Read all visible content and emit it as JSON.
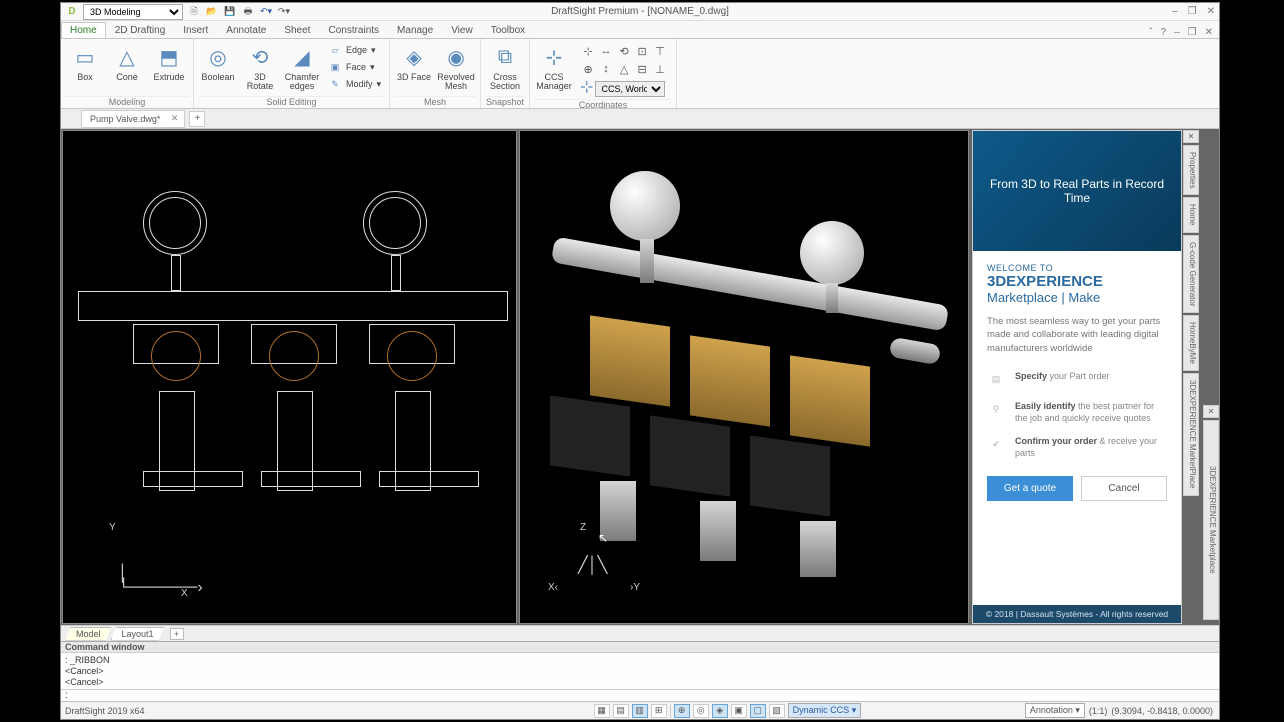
{
  "workspace": "3D Modeling",
  "app_title": "DraftSight Premium - [NONAME_0.dwg]",
  "window_controls": {
    "min": "–",
    "max": "❐",
    "close": "✕"
  },
  "menu_right": {
    "expand": "ˇ",
    "help": "?",
    "min": "–",
    "max": "❐",
    "close": "✕"
  },
  "tabs": {
    "items": [
      "Home",
      "2D Drafting",
      "Insert",
      "Annotate",
      "Sheet",
      "Constraints",
      "Manage",
      "View",
      "Toolbox"
    ],
    "active": "Home"
  },
  "ribbon": {
    "modeling": {
      "label": "Modeling",
      "box": "Box",
      "cone": "Cone",
      "extrude": "Extrude"
    },
    "solid_editing": {
      "label": "Solid Editing",
      "boolean": "Boolean",
      "rotate": "3D Rotate",
      "chamfer": "Chamfer edges",
      "edge": "Edge",
      "face": "Face",
      "modify": "Modify"
    },
    "mesh": {
      "label": "Mesh",
      "face3d": "3D Face",
      "revolved": "Revolved Mesh"
    },
    "snapshot": {
      "label": "Snapshot",
      "cross": "Cross Section"
    },
    "coords": {
      "label": "Coordinates",
      "ccs": "CCS Manager",
      "sys_label": "CCS, World"
    }
  },
  "file_tab": {
    "name": "Pump Valve.dwg*"
  },
  "viewport": {
    "left_axes": {
      "x": "X",
      "y": "Y"
    },
    "right_axes": {
      "x": "X",
      "y": "Y",
      "z": "Z"
    }
  },
  "panel": {
    "banner": "From 3D to Real Parts in Record Time",
    "welcome": "WELCOME TO",
    "title1": "3DEXPERIENCE",
    "title2": "Marketplace | Make",
    "desc": "The most seamless way to get your parts made and collaborate with leading digital manufacturers worldwide",
    "feat1_b": "Specify",
    "feat1_t": " your Part order",
    "feat2_b": "Easily identify",
    "feat2_t": " the best partner for the job and quickly receive quotes",
    "feat3_b": "Confirm your order",
    "feat3_t": " & receive your parts",
    "btn_primary": "Get a quote",
    "btn_cancel": "Cancel",
    "footer": "© 2018 | Dassault Systèmes - All rights reserved"
  },
  "vtabs": [
    "Properties",
    "Home",
    "G-code Generator",
    "HomeByMe",
    "3DEXPERIENCE MarketPlace"
  ],
  "vtab_secondary": "3DEXPERIENCE Marketplace",
  "sheet_tabs": {
    "model": "Model",
    "layout": "Layout1"
  },
  "cmd": {
    "title": "Command window",
    "lines": [
      ": _RIBBON",
      "<Cancel>",
      "<Cancel>"
    ],
    "prompt": ":"
  },
  "status": {
    "version": "DraftSight 2019 x64",
    "toggles": [
      "▦",
      "▤",
      "▥",
      "⊞",
      "⊕",
      "◎",
      "◈",
      "▣",
      "▢",
      "▧"
    ],
    "dynccs": "Dynamic CCS",
    "annotation": "Annotation",
    "scale": "(1:1)",
    "coords": "(9.3094, -0.8418, 0.0000)"
  }
}
